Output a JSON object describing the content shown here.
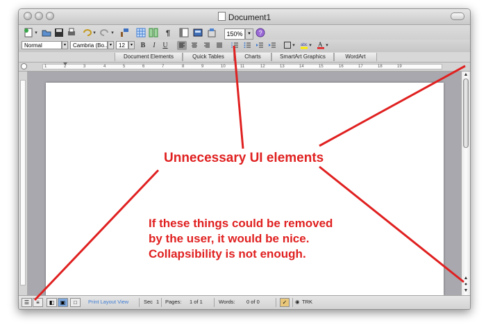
{
  "window": {
    "title": "Document1"
  },
  "toolbar": {
    "zoom": "150%",
    "pilcrow": "¶"
  },
  "formatting": {
    "style": "Normal",
    "font": "Cambria (Bo...",
    "size": "12",
    "bold": "B",
    "italic": "I",
    "underline": "U"
  },
  "elements_gallery": {
    "tabs": [
      "Document Elements",
      "Quick Tables",
      "Charts",
      "SmartArt Graphics",
      "WordArt"
    ]
  },
  "ruler": {
    "labels": [
      "1",
      "2",
      "3",
      "4",
      "5",
      "6",
      "7",
      "8",
      "9",
      "10",
      "11",
      "12",
      "13",
      "14",
      "15",
      "16",
      "17",
      "18",
      "19"
    ]
  },
  "status": {
    "view": "Print Layout View",
    "sec_label": "Sec",
    "sec_value": "1",
    "pages_label": "Pages:",
    "pages_value": "1 of 1",
    "words_label": "Words:",
    "words_value": "0 of 0",
    "trk": "TRK"
  },
  "annotations": {
    "headline": "Unnecessary UI elements",
    "note_lines": [
      "If these things could be removed",
      "by the user, it would be nice.",
      "Collapsibility is not enough."
    ]
  },
  "colors": {
    "annotation": "#e02020",
    "accent": "#3d8ee8"
  }
}
